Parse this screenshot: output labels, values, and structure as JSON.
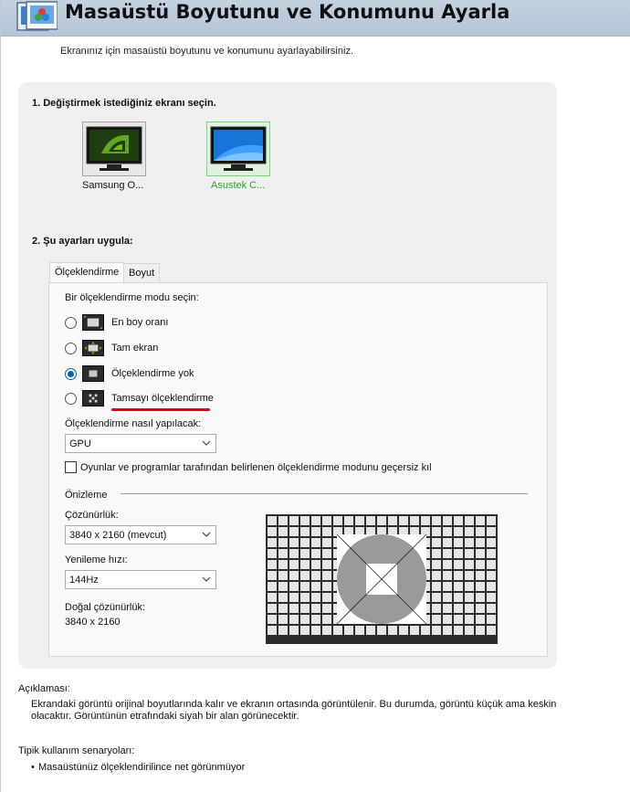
{
  "header": {
    "title": "Masaüstü Boyutunu ve Konumunu Ayarla",
    "subtitle": "Ekranınız için masaüstü boyutunu ve konumunu ayarlayabilirsiniz."
  },
  "section1": {
    "title": "1. Değiştirmek istediğiniz ekranı seçin.",
    "displays": [
      {
        "label": "Samsung O...",
        "selected": false
      },
      {
        "label": "Asustek C...",
        "selected": true
      }
    ]
  },
  "section2": {
    "title": "2. Şu ayarları uygula:",
    "tabs": [
      {
        "label": "Ölçeklendirme",
        "active": true
      },
      {
        "label": "Boyut",
        "active": false
      }
    ]
  },
  "scaling": {
    "mode_prompt": "Bir ölçeklendirme modu seçin:",
    "modes": [
      {
        "label": "En boy oranı",
        "checked": false
      },
      {
        "label": "Tam ekran",
        "checked": false
      },
      {
        "label": "Ölçeklendirme yok",
        "checked": true
      },
      {
        "label": "Tamsayı ölçeklendirme",
        "checked": false
      }
    ],
    "method_label": "Ölçeklendirme nasıl yapılacak:",
    "method_value": "GPU",
    "override_label": "Oyunlar ve programlar tarafından belirlenen ölçeklendirme modunu geçersiz kıl",
    "override_checked": false
  },
  "preview": {
    "title": "Önizleme",
    "resolution_label": "Çözünürlük:",
    "resolution_value": "3840 x 2160 (mevcut)",
    "refresh_label": "Yenileme hızı:",
    "refresh_value": "144Hz",
    "native_label": "Doğal çözünürlük:",
    "native_value": "3840 x 2160"
  },
  "description": {
    "title": "Açıklaması:",
    "text": "Ekrandaki görüntü orijinal boyutlarında kalır ve ekranın ortasında görüntülenir. Bu durumda, görüntü küçük ama keskin olacaktır. Görüntünün etrafındaki siyah bir alan görünecektir."
  },
  "usage": {
    "title": "Tipik kullanım senaryoları:",
    "items": [
      "Masaüstünüz ölçeklendirilince net görünmüyor"
    ]
  },
  "colors": {
    "header_bg": "#b9c9db",
    "selected_green": "#2e9e2e",
    "radio_blue": "#0063b1",
    "underline_red": "#e0001b"
  }
}
